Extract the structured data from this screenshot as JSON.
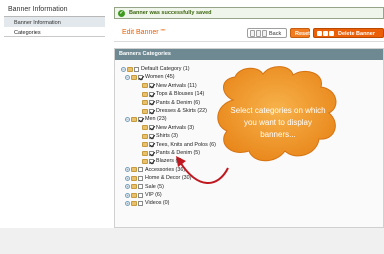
{
  "sidebar": {
    "title": "Banner Information",
    "items": [
      {
        "label": "Banner Information",
        "active": true
      },
      {
        "label": "Categories",
        "active": false
      }
    ]
  },
  "message": {
    "text": "Banner was successfully saved",
    "type": "success"
  },
  "header": {
    "title": "Edit Banner \"\"",
    "back_label": "Back",
    "reset_label": "Reset",
    "delete_label": "Delete Banner"
  },
  "panel": {
    "title": "Banners Categories",
    "tree": [
      {
        "label": "Default Category (1)",
        "level": 0,
        "checked": false,
        "toggle": "−"
      },
      {
        "label": "Women (45)",
        "level": 1,
        "checked": true,
        "toggle": "−"
      },
      {
        "label": "New Arrivals (11)",
        "level": 2,
        "checked": true,
        "toggle": ""
      },
      {
        "label": "Tops & Blouses (14)",
        "level": 2,
        "checked": true,
        "toggle": ""
      },
      {
        "label": "Pants & Denim (6)",
        "level": 2,
        "checked": true,
        "toggle": ""
      },
      {
        "label": "Dresses & Skirts (22)",
        "level": 2,
        "checked": true,
        "toggle": ""
      },
      {
        "label": "Men (23)",
        "level": 1,
        "checked": true,
        "toggle": "−"
      },
      {
        "label": "New Arrivals (3)",
        "level": 2,
        "checked": true,
        "toggle": ""
      },
      {
        "label": "Shirts (3)",
        "level": 2,
        "checked": true,
        "toggle": ""
      },
      {
        "label": "Tees, Knits and Polos (6)",
        "level": 2,
        "checked": true,
        "toggle": ""
      },
      {
        "label": "Pants & Denim (5)",
        "level": 2,
        "checked": true,
        "toggle": ""
      },
      {
        "label": "Blazers (8)",
        "level": 2,
        "checked": true,
        "toggle": ""
      },
      {
        "label": "Accessories (36)",
        "level": 1,
        "checked": false,
        "toggle": "+"
      },
      {
        "label": "Home & Decor (30)",
        "level": 1,
        "checked": false,
        "toggle": "+"
      },
      {
        "label": "Sale (5)",
        "level": 1,
        "checked": false,
        "toggle": "+"
      },
      {
        "label": "VIP (6)",
        "level": 1,
        "checked": false,
        "toggle": "+"
      },
      {
        "label": "Videos (0)",
        "level": 1,
        "checked": false,
        "toggle": "+"
      }
    ]
  },
  "callout": {
    "text": "Select categories on which you want to display banners..."
  },
  "colors": {
    "accent": "#eb5f06",
    "panel_header": "#6f8992",
    "success": "#3d6611",
    "callout": "#f0a02c"
  }
}
